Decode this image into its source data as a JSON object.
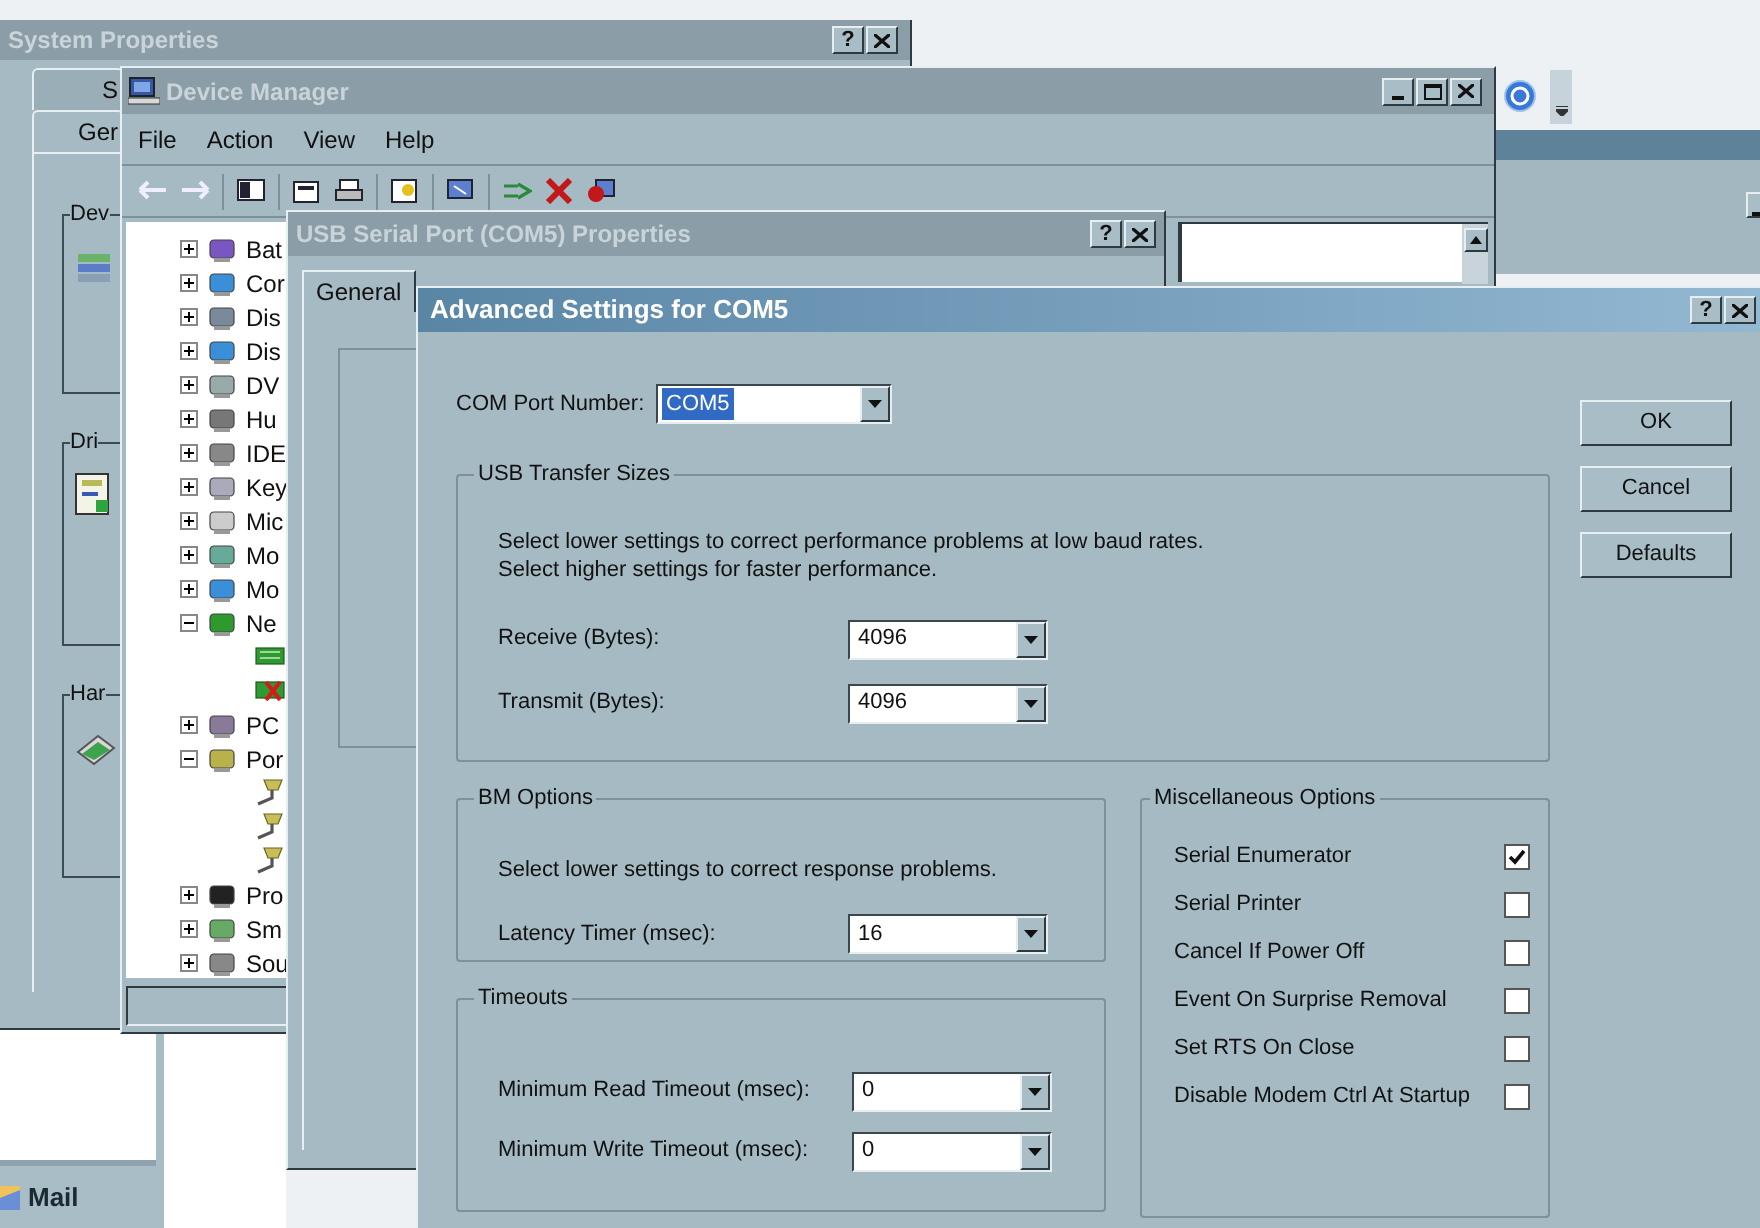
{
  "system_properties": {
    "title": "System Properties",
    "help_button": "?",
    "tabs": [
      {
        "label": "S",
        "selected": false
      },
      {
        "label": "Ger",
        "selected": true
      }
    ],
    "groups": [
      "Dev",
      "Dri",
      "Har"
    ]
  },
  "device_manager": {
    "title": "Device Manager",
    "menu": [
      "File",
      "Action",
      "View",
      "Help"
    ],
    "tree": [
      {
        "label": "Bat",
        "expanded": false
      },
      {
        "label": "Cor",
        "expanded": false
      },
      {
        "label": "Dis",
        "expanded": false
      },
      {
        "label": "Dis",
        "expanded": false
      },
      {
        "label": "DV",
        "expanded": false
      },
      {
        "label": "Hu",
        "expanded": false
      },
      {
        "label": "IDE",
        "expanded": false
      },
      {
        "label": "Key",
        "expanded": false
      },
      {
        "label": "Mic",
        "expanded": false
      },
      {
        "label": "Mo",
        "expanded": false
      },
      {
        "label": "Mo",
        "expanded": false
      },
      {
        "label": "Ne",
        "expanded": true,
        "children": [
          {
            "kind": "adapter"
          },
          {
            "kind": "adapter_disabled"
          }
        ]
      },
      {
        "label": "PC",
        "expanded": false
      },
      {
        "label": "Por",
        "expanded": true,
        "children": [
          {
            "kind": "port"
          },
          {
            "kind": "port"
          },
          {
            "kind": "port"
          }
        ]
      },
      {
        "label": "Pro",
        "expanded": false
      },
      {
        "label": "Sm",
        "expanded": false
      },
      {
        "label": "Sou",
        "expanded": false
      }
    ]
  },
  "usb_properties": {
    "title": "USB Serial Port (COM5) Properties",
    "help_button": "?",
    "tabs": [
      {
        "label": "General",
        "selected": true
      }
    ]
  },
  "advanced_settings": {
    "title": "Advanced Settings for COM5",
    "help_button": "?",
    "com_port": {
      "label": "COM Port Number:",
      "value": "COM5",
      "focused": true
    },
    "usb_transfer_sizes": {
      "title": "USB Transfer Sizes",
      "notes": [
        "Select lower settings to correct performance problems at low baud rates.",
        "Select higher settings for faster performance."
      ],
      "fields": [
        {
          "label": "Receive (Bytes):",
          "value": "4096"
        },
        {
          "label": "Transmit (Bytes):",
          "value": "4096"
        }
      ]
    },
    "bm_options": {
      "title": "BM Options",
      "note": "Select lower settings to correct response problems.",
      "fields": [
        {
          "label": "Latency Timer (msec):",
          "value": "16"
        }
      ]
    },
    "timeouts": {
      "title": "Timeouts",
      "fields": [
        {
          "label": "Minimum Read Timeout (msec):",
          "value": "0"
        },
        {
          "label": "Minimum Write Timeout (msec):",
          "value": "0"
        }
      ]
    },
    "misc_options": {
      "title": "Miscellaneous Options",
      "items": [
        {
          "label": "Serial Enumerator",
          "checked": true
        },
        {
          "label": "Serial Printer",
          "checked": false
        },
        {
          "label": "Cancel If Power Off",
          "checked": false
        },
        {
          "label": "Event On Surprise Removal",
          "checked": false
        },
        {
          "label": "Set RTS On Close",
          "checked": false
        },
        {
          "label": "Disable Modem Ctrl At Startup",
          "checked": false
        }
      ]
    },
    "buttons": [
      "OK",
      "Cancel",
      "Defaults"
    ]
  },
  "taskbar": {
    "label": "Mail"
  }
}
